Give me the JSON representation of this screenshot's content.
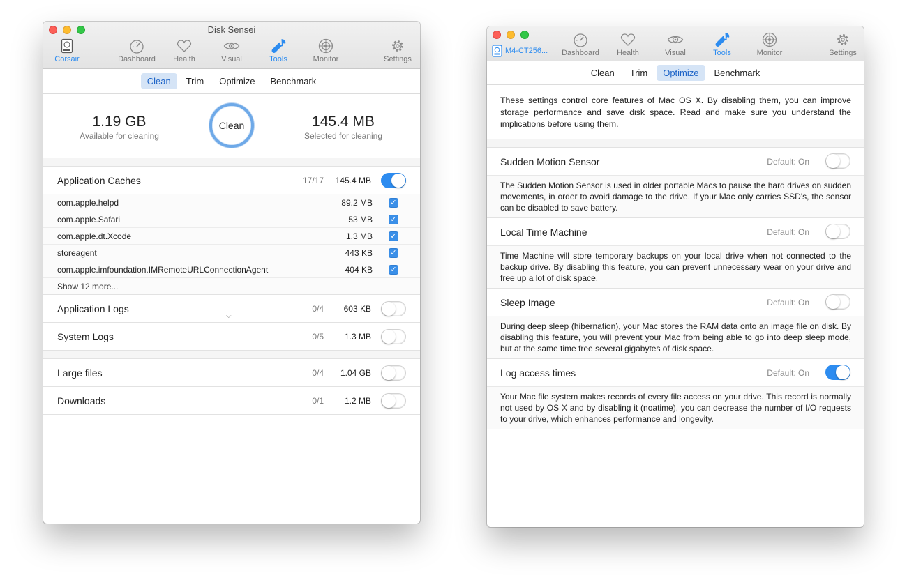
{
  "window1": {
    "title": "Disk Sensei",
    "disk_label": "Corsair",
    "toolbar": [
      {
        "label": "Dashboard",
        "icon": "gauge-icon"
      },
      {
        "label": "Health",
        "icon": "heart-icon"
      },
      {
        "label": "Visual",
        "icon": "eye-icon"
      },
      {
        "label": "Tools",
        "icon": "wrench-icon",
        "active": true
      },
      {
        "label": "Monitor",
        "icon": "target-icon"
      },
      {
        "label": "Settings",
        "icon": "gear-icon"
      }
    ],
    "tabs": [
      "Clean",
      "Trim",
      "Optimize",
      "Benchmark"
    ],
    "active_tab": "Clean",
    "available": {
      "value": "1.19 GB",
      "label": "Available for cleaning"
    },
    "selected": {
      "value": "145.4 MB",
      "label": "Selected for cleaning"
    },
    "clean_button": "Clean",
    "app_caches": {
      "name": "Application Caches",
      "count": "17/17",
      "size": "145.4 MB",
      "enabled": true,
      "items": [
        {
          "name": "com.apple.helpd",
          "size": "89.2 MB"
        },
        {
          "name": "com.apple.Safari",
          "size": "53 MB"
        },
        {
          "name": "com.apple.dt.Xcode",
          "size": "1.3 MB"
        },
        {
          "name": "storeagent",
          "size": "443 KB"
        },
        {
          "name": "com.apple.imfoundation.IMRemoteURLConnectionAgent",
          "size": "404 KB"
        }
      ],
      "show_more": "Show 12 more..."
    },
    "app_logs": {
      "name": "Application Logs",
      "count": "0/4",
      "size": "603 KB",
      "enabled": false
    },
    "sys_logs": {
      "name": "System Logs",
      "count": "0/5",
      "size": "1.3 MB",
      "enabled": false
    },
    "large_files": {
      "name": "Large files",
      "count": "0/4",
      "size": "1.04 GB",
      "enabled": false
    },
    "downloads": {
      "name": "Downloads",
      "count": "0/1",
      "size": "1.2 MB",
      "enabled": false
    }
  },
  "window2": {
    "disk_label": "M4-CT256...",
    "toolbar": [
      {
        "label": "Dashboard",
        "icon": "gauge-icon"
      },
      {
        "label": "Health",
        "icon": "heart-icon"
      },
      {
        "label": "Visual",
        "icon": "eye-icon"
      },
      {
        "label": "Tools",
        "icon": "wrench-icon",
        "active": true
      },
      {
        "label": "Monitor",
        "icon": "target-icon"
      },
      {
        "label": "Settings",
        "icon": "gear-icon"
      }
    ],
    "tabs": [
      "Clean",
      "Trim",
      "Optimize",
      "Benchmark"
    ],
    "active_tab": "Optimize",
    "intro": "These settings control core features of Mac OS X. By disabling them, you can improve storage performance and save disk space. Read and make sure you understand the implications before using them.",
    "options": [
      {
        "name": "Sudden Motion Sensor",
        "default": "Default: On",
        "enabled": false,
        "desc": "The Sudden Motion Sensor is used in older portable Macs to pause the hard drives on sudden movements, in order to avoid damage to the drive. If your Mac only carries SSD's, the sensor can be disabled to save battery."
      },
      {
        "name": "Local Time Machine",
        "default": "Default: On",
        "enabled": false,
        "desc": "Time Machine will store temporary backups on your local drive when not connected to the backup drive. By disabling this feature, you can prevent unnecessary wear on your drive and free up a lot of disk space."
      },
      {
        "name": "Sleep Image",
        "default": "Default: On",
        "enabled": false,
        "desc": "During deep sleep (hibernation), your Mac stores the RAM data onto an image file on disk. By disabling this feature, you will prevent your Mac from being able to go into deep sleep mode, but at the same time free several gigabytes of disk space."
      },
      {
        "name": "Log access times",
        "default": "Default: On",
        "enabled": true,
        "desc": "Your Mac file system makes records of every file access on your drive. This record is normally not used by OS X and by disabling it (noatime), you can decrease the number of I/O requests to your drive, which enhances performance and longevity."
      }
    ]
  },
  "colors": {
    "accent": "#2d8cf0",
    "tab_active_bg": "#d5e4f6",
    "close": "#fc5f57",
    "minimize": "#fdbc2e",
    "zoom": "#33c748"
  }
}
